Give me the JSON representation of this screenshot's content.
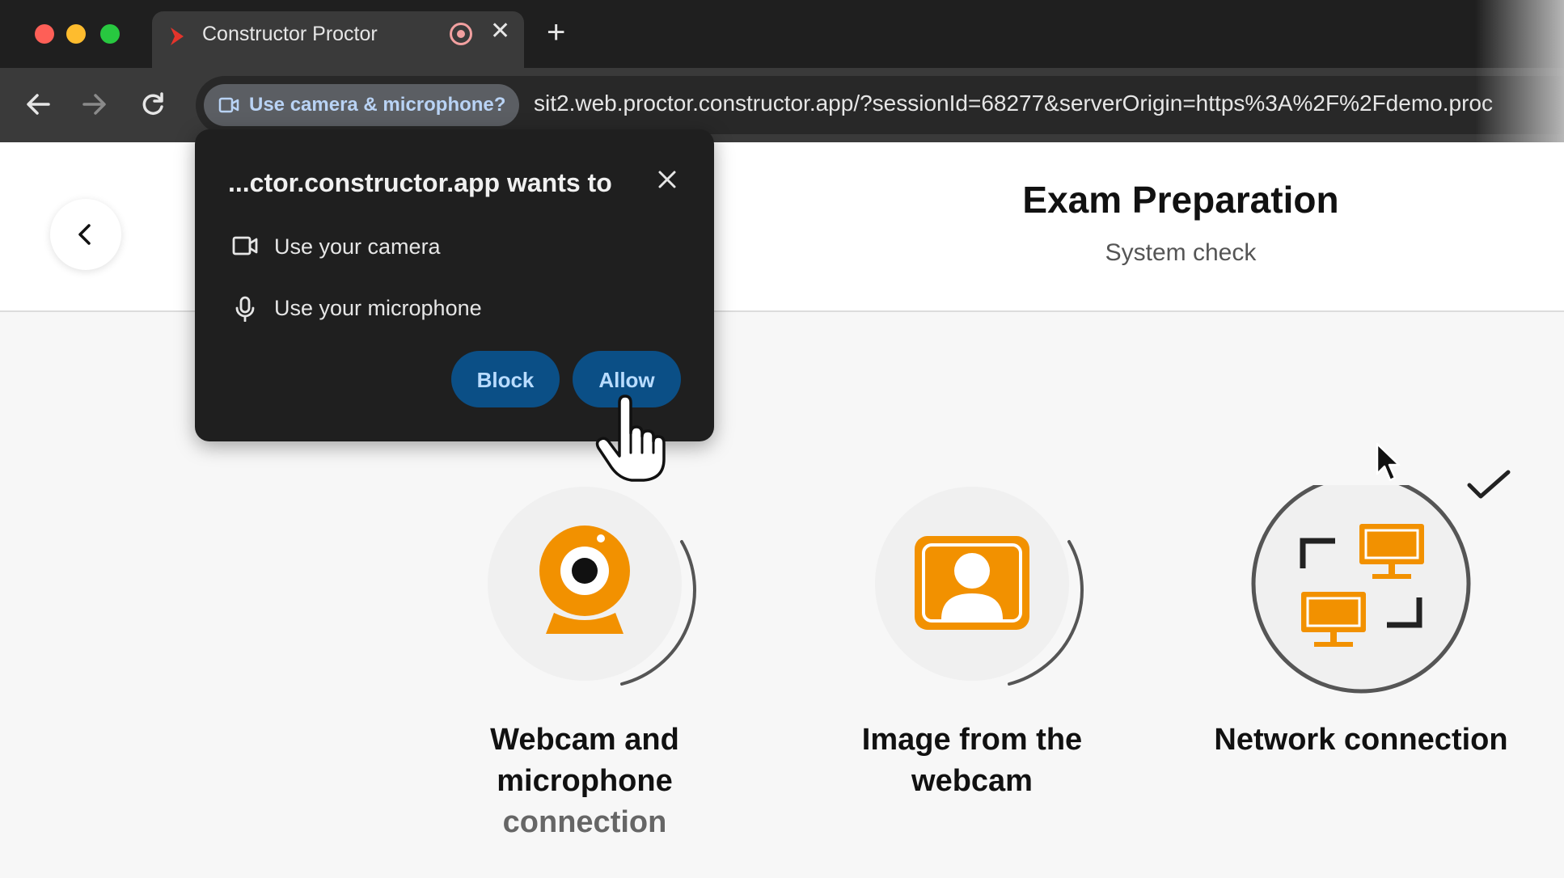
{
  "window": {
    "tab_title": "Constructor Proctor",
    "new_tab_symbol": "+",
    "close_symbol": "✕"
  },
  "toolbar": {
    "permission_chip_label": "Use camera & microphone?",
    "url": "sit2.web.proctor.constructor.app/?sessionId=68277&serverOrigin=https%3A%2F%2Fdemo.proc"
  },
  "popup": {
    "title": "...ctor.constructor.app wants to",
    "permissions": [
      {
        "label": "Use your camera",
        "icon": "video-camera-icon"
      },
      {
        "label": "Use your microphone",
        "icon": "microphone-icon"
      }
    ],
    "block_label": "Block",
    "allow_label": "Allow"
  },
  "page": {
    "title": "Exam Preparation",
    "subtitle": "System check",
    "checks": [
      {
        "line1": "Webcam and",
        "line2": "microphone",
        "line3": "connection",
        "icon": "webcam-icon",
        "status": "in-progress"
      },
      {
        "line1": "Image from the",
        "line2": "webcam",
        "icon": "user-portrait-icon",
        "status": "in-progress"
      },
      {
        "line1": "Network connection",
        "icon": "network-computers-icon",
        "status": "passed"
      }
    ]
  },
  "colors": {
    "accent_orange": "#f29100",
    "button_blue": "#0b4f86",
    "chip_text": "#b9d3f5"
  }
}
